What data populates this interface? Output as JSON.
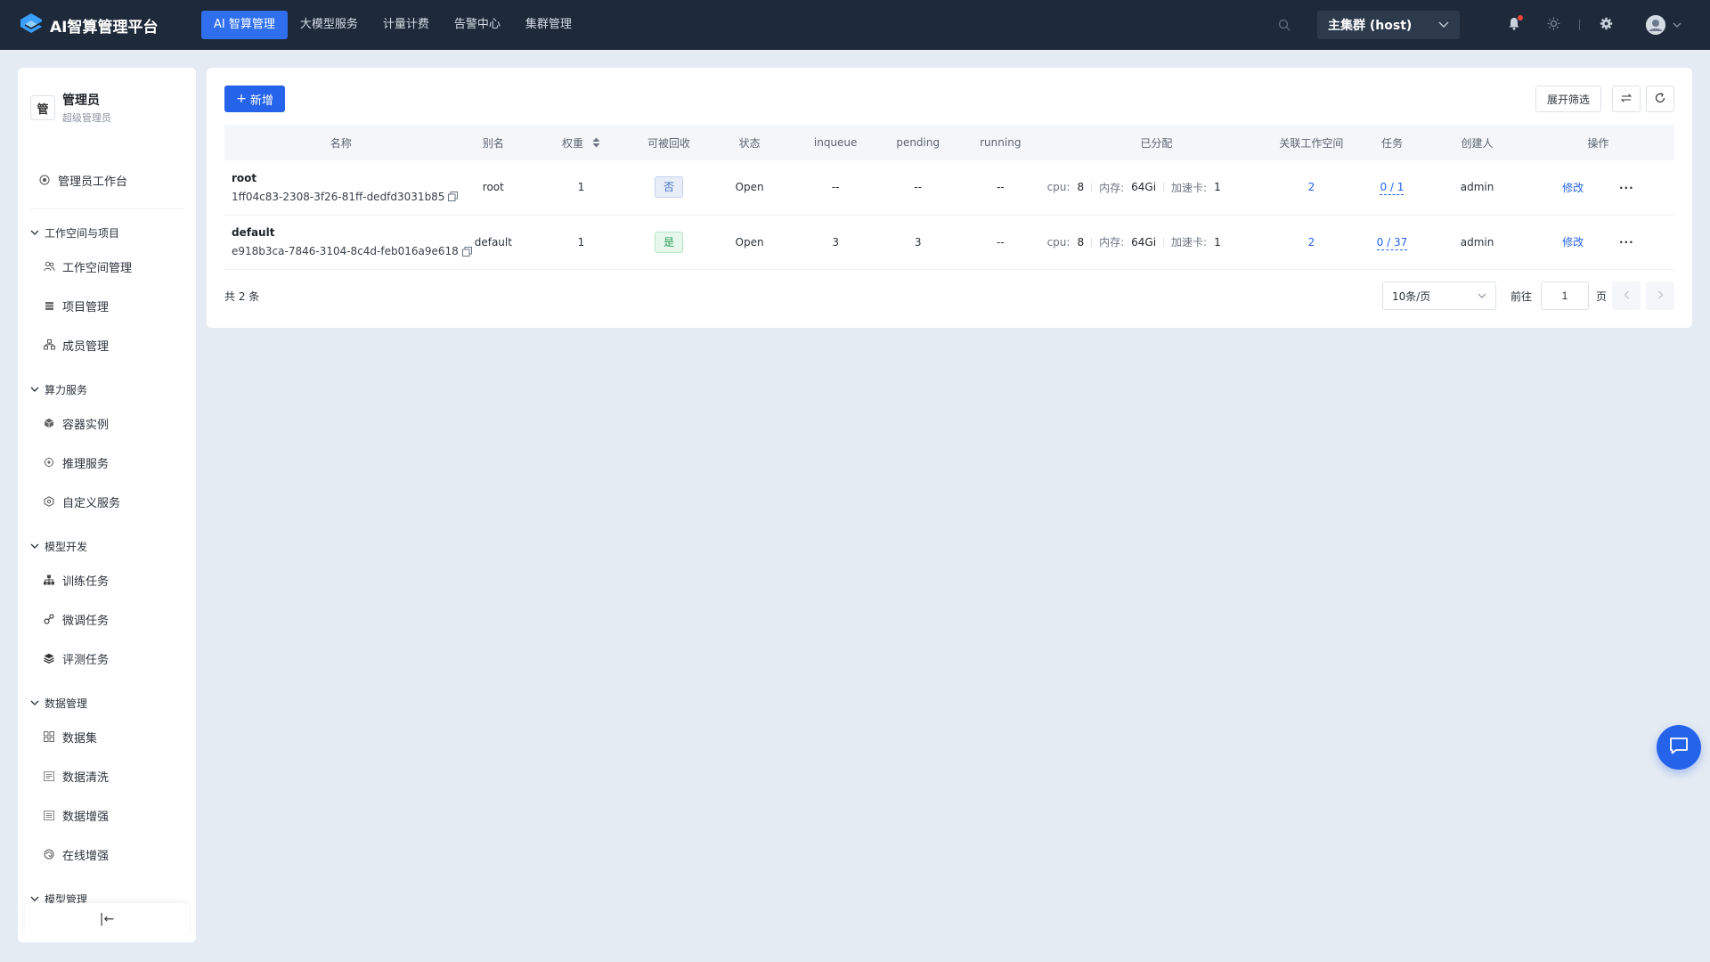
{
  "app": {
    "title": "AI智算管理平台"
  },
  "topnav": [
    {
      "label": "AI 智算管理",
      "active": true
    },
    {
      "label": "大模型服务"
    },
    {
      "label": "计量计费"
    },
    {
      "label": "告警中心"
    },
    {
      "label": "集群管理"
    }
  ],
  "cluster": {
    "selected": "主集群 (host)"
  },
  "user": {
    "badge": "管",
    "name": "管理员",
    "role": "超级管理员"
  },
  "sidebar": {
    "top_item": "管理员工作台",
    "groups": [
      {
        "label": "工作空间与项目",
        "items": [
          {
            "label": "工作空间管理"
          },
          {
            "label": "项目管理"
          },
          {
            "label": "成员管理"
          }
        ]
      },
      {
        "label": "算力服务",
        "items": [
          {
            "label": "容器实例"
          },
          {
            "label": "推理服务"
          },
          {
            "label": "自定义服务"
          }
        ]
      },
      {
        "label": "模型开发",
        "items": [
          {
            "label": "训练任务"
          },
          {
            "label": "微调任务"
          },
          {
            "label": "评测任务"
          }
        ]
      },
      {
        "label": "数据管理",
        "items": [
          {
            "label": "数据集"
          },
          {
            "label": "数据清洗"
          },
          {
            "label": "数据增强"
          },
          {
            "label": "在线增强"
          }
        ]
      },
      {
        "label": "模型管理",
        "items": []
      }
    ],
    "collapse_icon": "|←"
  },
  "toolbar": {
    "add_label": "新增",
    "add_icon": "+",
    "filter_label": "展开筛选"
  },
  "table": {
    "columns": [
      "名称",
      "别名",
      "权重",
      "可被回收",
      "状态",
      "inqueue",
      "pending",
      "running",
      "已分配",
      "关联工作空间",
      "任务",
      "创建人",
      "操作"
    ],
    "rows": [
      {
        "name": "root",
        "id": "1ff04c83-2308-3f26-81ff-dedfd3031b85",
        "alias": "root",
        "weight": "1",
        "reclaimable": "否",
        "status": "Open",
        "inqueue": "--",
        "pending": "--",
        "running": "--",
        "cpu_label": "cpu:",
        "cpu": "8",
        "mem_label": "内存:",
        "mem": "64Gi",
        "acc_label": "加速卡:",
        "acc": "1",
        "workspaces": "2",
        "tasks": "0 / 1",
        "creator": "admin",
        "edit": "修改",
        "more": "···"
      },
      {
        "name": "default",
        "id": "e918b3ca-7846-3104-8c4d-feb016a9e618",
        "alias": "default",
        "weight": "1",
        "reclaimable": "是",
        "status": "Open",
        "inqueue": "3",
        "pending": "3",
        "running": "--",
        "cpu_label": "cpu:",
        "cpu": "8",
        "mem_label": "内存:",
        "mem": "64Gi",
        "acc_label": "加速卡:",
        "acc": "1",
        "workspaces": "2",
        "tasks": "0 / 37",
        "creator": "admin",
        "edit": "修改",
        "more": "···"
      }
    ]
  },
  "pagination": {
    "total": "共 2 条",
    "page_size": "10条/页",
    "goto_label": "前往",
    "page_value": "1",
    "page_unit": "页"
  },
  "colors": {
    "topbar": "#1e2a3a",
    "accent": "#2563eb",
    "background": "#e5ebf2"
  }
}
